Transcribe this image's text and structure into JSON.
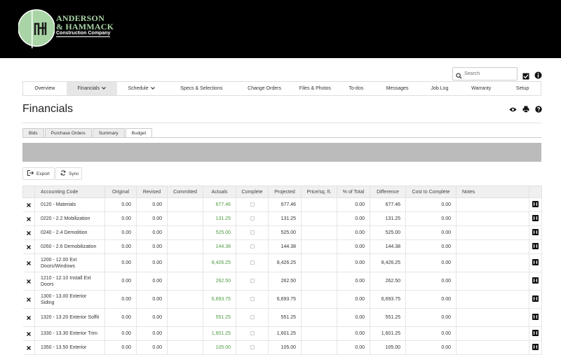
{
  "brand": {
    "line1": "ANDERSON",
    "line2": "& HAMMACK",
    "line3": "Construction Company",
    "accent": "#a9d5a6"
  },
  "search": {
    "placeholder": "Search"
  },
  "nav": [
    {
      "label": "Overview",
      "active": false,
      "dropdown": false
    },
    {
      "label": "Financials",
      "active": true,
      "dropdown": true
    },
    {
      "label": "Schedule",
      "active": false,
      "dropdown": true
    },
    {
      "label": "Specs & Selections",
      "active": false,
      "dropdown": false
    },
    {
      "label": "Change Orders",
      "active": false,
      "dropdown": false
    },
    {
      "label": "Files & Photos",
      "active": false,
      "dropdown": false
    },
    {
      "label": "To-dos",
      "active": false,
      "dropdown": false
    },
    {
      "label": "Messages",
      "active": false,
      "dropdown": false
    },
    {
      "label": "Job Log",
      "active": false,
      "dropdown": false
    },
    {
      "label": "Warranty",
      "active": false,
      "dropdown": false
    },
    {
      "label": "Setup",
      "active": false,
      "dropdown": false
    }
  ],
  "page": {
    "title": "Financials"
  },
  "tabs": [
    {
      "label": "Bids",
      "active": false
    },
    {
      "label": "Purchase Orders",
      "active": false
    },
    {
      "label": "Summary",
      "active": false
    },
    {
      "label": "Budget",
      "active": true
    }
  ],
  "toolbar": {
    "export_label": "Export",
    "sync_label": "Sync"
  },
  "table": {
    "columns": [
      "Accounting Code",
      "Original",
      "Revised",
      "Committed",
      "Actuals",
      "Complete",
      "Projected",
      "Price/sq. ft.",
      "% of Total",
      "Difference",
      "Cost to Complete",
      "Notes"
    ],
    "rows": [
      {
        "code": "0120 - Materials",
        "original": "0.00",
        "revised": "0.00",
        "committed": "",
        "actuals": "677.46",
        "projected": "677.46",
        "price_sqft": "",
        "pct_total": "0.00",
        "difference": "677.46",
        "cost_to_complete": "0.00"
      },
      {
        "code": "0220 - 2.2 Mobilization",
        "original": "0.00",
        "revised": "0.00",
        "committed": "",
        "actuals": "131.25",
        "projected": "131.25",
        "price_sqft": "",
        "pct_total": "0.00",
        "difference": "131.25",
        "cost_to_complete": "0.00"
      },
      {
        "code": "0240 - 2.4 Demolition",
        "original": "0.00",
        "revised": "0.00",
        "committed": "",
        "actuals": "525.00",
        "projected": "525.00",
        "price_sqft": "",
        "pct_total": "0.00",
        "difference": "525.00",
        "cost_to_complete": "0.00"
      },
      {
        "code": "0260 - 2.6 Demobilization",
        "original": "0.00",
        "revised": "0.00",
        "committed": "",
        "actuals": "144.38",
        "projected": "144.38",
        "price_sqft": "",
        "pct_total": "0.00",
        "difference": "144.38",
        "cost_to_complete": "0.00"
      },
      {
        "code": "1200 - 12.00 Ext Doors/Windows",
        "original": "0.00",
        "revised": "0.00",
        "committed": "",
        "actuals": "8,426.25",
        "projected": "8,426.25",
        "price_sqft": "",
        "pct_total": "0.00",
        "difference": "8,426.25",
        "cost_to_complete": "0.00"
      },
      {
        "code": "1210 - 12.10 Install Ext Doors",
        "original": "0.00",
        "revised": "0.00",
        "committed": "",
        "actuals": "262.50",
        "projected": "262.50",
        "price_sqft": "",
        "pct_total": "0.00",
        "difference": "262.50",
        "cost_to_complete": "0.00"
      },
      {
        "code": "1300 - 13.00 Exterior Siding",
        "original": "0.00",
        "revised": "0.00",
        "committed": "",
        "actuals": "6,693.75",
        "projected": "6,693.75",
        "price_sqft": "",
        "pct_total": "0.00",
        "difference": "6,693.75",
        "cost_to_complete": "0.00"
      },
      {
        "code": "1320 - 13.20 Exterior Soffit",
        "original": "0.00",
        "revised": "0.00",
        "committed": "",
        "actuals": "551.25",
        "projected": "551.25",
        "price_sqft": "",
        "pct_total": "0.00",
        "difference": "551.25",
        "cost_to_complete": "0.00"
      },
      {
        "code": "1330 - 13.30 Exterior Trim",
        "original": "0.00",
        "revised": "0.00",
        "committed": "",
        "actuals": "1,601.25",
        "projected": "1,601.25",
        "price_sqft": "",
        "pct_total": "0.00",
        "difference": "1,601.25",
        "cost_to_complete": "0.00"
      },
      {
        "code": "1350 - 13.50 Exterior",
        "original": "0.00",
        "revised": "0.00",
        "committed": "",
        "actuals": "105.00",
        "projected": "105.00",
        "price_sqft": "",
        "pct_total": "0.00",
        "difference": "105.00",
        "cost_to_complete": "0.00"
      }
    ]
  }
}
